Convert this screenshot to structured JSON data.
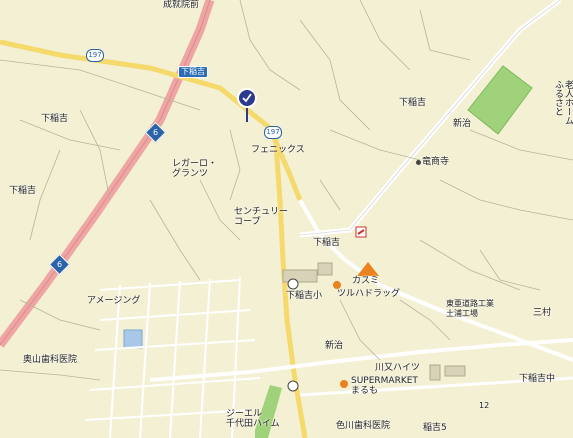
{
  "map": {
    "labels": {
      "top_cut": "成就院前",
      "shimo_inayoshi_1": "下稲吉",
      "shimo_inayoshi_2": "下稲吉",
      "shimo_inayoshi_3": "下稲吉",
      "shimo_inayoshi_4": "下稲吉",
      "phoenix": "フェニックス",
      "legado_grants": "レガーロ・\nグランツ",
      "century_court": "センチュリー\nコープ",
      "niiharu_1": "新治",
      "niiharu_2": "新治",
      "ryushoji": "竜商寺",
      "rojin_home": "老人ホーム\nふるさと",
      "amazing": "アメージング",
      "okuyama_dental": "奥山歯科医院",
      "shimo_inayoshi_sho": "下稲吉小",
      "kasumi": "カスミ",
      "tsuruha": "ツルハドラッグ",
      "tokai_factory": "東亜道路工業\n土浦工場",
      "sanmura": "三村",
      "kawamata_heights": "川又ハイツ",
      "supermarket": "SUPERMARKET\nまるも",
      "shimo_inayoshi_chu": "下稲吉中",
      "jeel_chiyoda": "ジーエル\n千代田ハイム",
      "irokawa_dental": "色川歯科医院",
      "inayoshi_5": "稲吉5",
      "number_12": "12"
    },
    "road_tags": {
      "shimo_inayoshi_jct": "下稲吉"
    },
    "route_numbers": {
      "national_6_a": "6",
      "national_6_b": "6",
      "pref_197_a": "197",
      "pref_197_b": "197"
    },
    "marker": "selected-location"
  }
}
